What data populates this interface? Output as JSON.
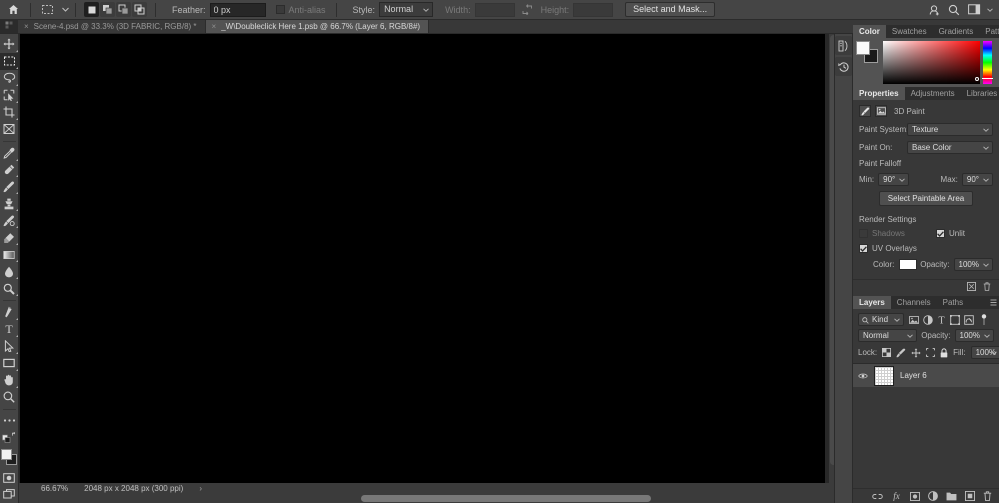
{
  "options_bar": {
    "home_icon": "home-icon",
    "active_tool_icon": "rectangular-marquee-icon",
    "tool_preset_caret": "chevron-down-icon",
    "boolean_modes": [
      {
        "name": "new-selection",
        "icon": "square-filled-icon",
        "active": true
      },
      {
        "name": "add-to-selection",
        "icon": "two-squares-icon",
        "active": false
      },
      {
        "name": "subtract-from-selection",
        "icon": "subtract-squares-icon",
        "active": false
      },
      {
        "name": "intersect-with-selection",
        "icon": "intersect-squares-icon",
        "active": false
      }
    ],
    "feather_label": "Feather:",
    "feather_value": "0 px",
    "antialias_label": "Anti-alias",
    "style_label": "Style:",
    "style_value": "Normal",
    "width_label": "Width:",
    "width_value": "",
    "swap_icon": "swap-width-height-icon",
    "height_label": "Height:",
    "height_value": "",
    "select_and_mask_label": "Select and Mask...",
    "right_icons": [
      {
        "name": "share-icon",
        "glyph": "share"
      },
      {
        "name": "search-icon",
        "glyph": "search"
      },
      {
        "name": "workspace-icon",
        "glyph": "workspace"
      },
      {
        "name": "workspace-chevron-icon",
        "glyph": "chevron"
      }
    ]
  },
  "tabs": [
    {
      "label": "Scene-4.psd @ 33.3% (3D FABRIC, RGB/8) *",
      "active": false,
      "close": "×"
    },
    {
      "label": "_W\\Doubleclick Here 1.psb @ 66.7% (Layer 6, RGB/8#)",
      "active": true,
      "close": "×"
    }
  ],
  "toolbar": {
    "tools": [
      {
        "name": "move-tool",
        "icon": "move-icon",
        "selected": false,
        "has_flyout": true
      },
      {
        "name": "rectangular-marquee-tool",
        "icon": "marquee-icon",
        "selected": true,
        "has_flyout": true
      },
      {
        "name": "lasso-tool",
        "icon": "lasso-icon",
        "selected": false,
        "has_flyout": true
      },
      {
        "name": "object-selection-tool",
        "icon": "quick-select-icon",
        "selected": false,
        "has_flyout": true
      },
      {
        "name": "crop-tool",
        "icon": "crop-icon",
        "selected": false,
        "has_flyout": true
      },
      {
        "name": "frame-tool",
        "icon": "frame-icon",
        "selected": false,
        "has_flyout": false
      },
      {
        "name": "eyedropper-tool",
        "icon": "eyedropper-icon",
        "selected": false,
        "has_flyout": true
      },
      {
        "name": "spot-healing-brush-tool",
        "icon": "healing-brush-icon",
        "selected": false,
        "has_flyout": true
      },
      {
        "name": "brush-tool",
        "icon": "brush-icon",
        "selected": false,
        "has_flyout": true
      },
      {
        "name": "clone-stamp-tool",
        "icon": "clone-stamp-icon",
        "selected": false,
        "has_flyout": true
      },
      {
        "name": "history-brush-tool",
        "icon": "history-brush-icon",
        "selected": false,
        "has_flyout": true
      },
      {
        "name": "eraser-tool",
        "icon": "eraser-icon",
        "selected": false,
        "has_flyout": true
      },
      {
        "name": "gradient-tool",
        "icon": "gradient-icon",
        "selected": false,
        "has_flyout": true
      },
      {
        "name": "blur-tool",
        "icon": "blur-drop-icon",
        "selected": false,
        "has_flyout": true
      },
      {
        "name": "dodge-tool",
        "icon": "dodge-icon",
        "selected": false,
        "has_flyout": true
      },
      {
        "name": "pen-tool",
        "icon": "pen-icon",
        "selected": false,
        "has_flyout": true
      },
      {
        "name": "type-tool",
        "icon": "type-icon",
        "selected": false,
        "has_flyout": true
      },
      {
        "name": "path-selection-tool",
        "icon": "path-arrow-icon",
        "selected": false,
        "has_flyout": true
      },
      {
        "name": "rectangle-tool",
        "icon": "rectangle-icon",
        "selected": false,
        "has_flyout": true
      },
      {
        "name": "hand-tool",
        "icon": "hand-icon",
        "selected": false,
        "has_flyout": true
      },
      {
        "name": "zoom-tool",
        "icon": "zoom-icon",
        "selected": false,
        "has_flyout": false
      },
      {
        "name": "edit-toolbar",
        "icon": "ellipsis-icon",
        "selected": false,
        "has_flyout": false
      },
      {
        "name": "default-colors",
        "icon": "default-colors-icon",
        "selected": false,
        "has_flyout": false
      }
    ],
    "foreground_color": "#f2f2f2",
    "background_color": "#1e1e1e",
    "quick_mask_name": "quick-mask-mode",
    "screen_mode_name": "screen-mode"
  },
  "canvas": {
    "background_color": "#000000",
    "vertical_scrollbar": "canvas-vertical-scrollbar",
    "horizontal_scrollbar": "canvas-horizontal-scrollbar"
  },
  "status_bar": {
    "zoom": "66.67%",
    "doc_info": "2048 px x 2048 px (300 ppi)",
    "expand_arrow": "›"
  },
  "dock_strip": {
    "icons": [
      {
        "name": "3d-panel-icon",
        "glyph": "3d"
      },
      {
        "name": "history-panel-icon",
        "glyph": "history"
      }
    ]
  },
  "color_panel": {
    "tabs": [
      {
        "label": "Color",
        "active": true
      },
      {
        "label": "Swatches",
        "active": false
      },
      {
        "label": "Gradients",
        "active": false
      },
      {
        "label": "Patterns",
        "active": false
      }
    ],
    "menu_icon": "panel-menu-icon",
    "foreground_color": "#ffffff",
    "background_color": "#1a1a1a",
    "spectrum_name": "color-spectrum-field",
    "hue_strip_name": "hue-slider"
  },
  "properties_panel": {
    "tabs": [
      {
        "label": "Properties",
        "active": true
      },
      {
        "label": "Adjustments",
        "active": false
      },
      {
        "label": "Libraries",
        "active": false
      }
    ],
    "menu_icon": "panel-menu-icon",
    "header_icons": [
      {
        "name": "paint-brush-mode-icon"
      },
      {
        "name": "texture-image-icon"
      }
    ],
    "header_title": "3D Paint",
    "paint_system_label": "Paint System:",
    "paint_system_value": "Texture",
    "paint_on_label": "Paint On:",
    "paint_on_value": "Base Color",
    "paint_falloff_title": "Paint Falloff",
    "min_label": "Min:",
    "min_value": "90°",
    "max_label": "Max:",
    "max_value": "90°",
    "select_paintable_area_label": "Select Paintable Area",
    "render_settings_title": "Render Settings",
    "shadows_label": "Shadows",
    "shadows_checked": false,
    "shadows_enabled": false,
    "unlit_label": "Unlit",
    "unlit_checked": true,
    "uv_overlays_label": "UV Overlays",
    "uv_overlays_checked": true,
    "color_label": "Color:",
    "color_value": "#ffffff",
    "opacity_label": "Opacity:",
    "opacity_value": "100%",
    "footer_icons": [
      {
        "name": "reset-properties-icon"
      },
      {
        "name": "delete-properties-icon"
      }
    ]
  },
  "layers_panel": {
    "tabs": [
      {
        "label": "Layers",
        "active": true
      },
      {
        "label": "Channels",
        "active": false
      },
      {
        "label": "Paths",
        "active": false
      }
    ],
    "menu_icon": "panel-menu-icon",
    "filter_kind_label": "Kind",
    "filter_search_icon": "search-icon",
    "filter_icons": [
      {
        "name": "filter-pixel-layers-icon"
      },
      {
        "name": "filter-adjustment-layers-icon"
      },
      {
        "name": "filter-type-layers-icon"
      },
      {
        "name": "filter-shape-layers-icon"
      },
      {
        "name": "filter-smart-objects-icon"
      }
    ],
    "filter_toggle_icon": "filter-toggle-switch-icon",
    "blend_mode": "Normal",
    "opacity_label": "Opacity:",
    "opacity_value": "100%",
    "lock_label": "Lock:",
    "lock_icons": [
      {
        "name": "lock-transparent-pixels-icon"
      },
      {
        "name": "lock-image-pixels-icon"
      },
      {
        "name": "lock-position-icon"
      },
      {
        "name": "lock-artboard-nesting-icon"
      },
      {
        "name": "lock-all-icon"
      }
    ],
    "fill_label": "Fill:",
    "fill_value": "100%",
    "layers": [
      {
        "name": "Layer 6",
        "visible": true,
        "selected": true,
        "thumbnail": "checkerboard-layer-thumbnail"
      }
    ],
    "footer_icons": [
      {
        "name": "link-layers-icon"
      },
      {
        "name": "layer-style-icon"
      },
      {
        "name": "add-layer-mask-icon"
      },
      {
        "name": "new-adjustment-layer-icon"
      },
      {
        "name": "new-group-icon"
      },
      {
        "name": "new-layer-icon"
      },
      {
        "name": "delete-layer-icon"
      }
    ]
  },
  "colors": {
    "chrome": "#383838",
    "options_bar": "#454545",
    "panel_tab_active": "#535353",
    "canvas": "#000000",
    "selected_row": "#4a4a4a"
  }
}
